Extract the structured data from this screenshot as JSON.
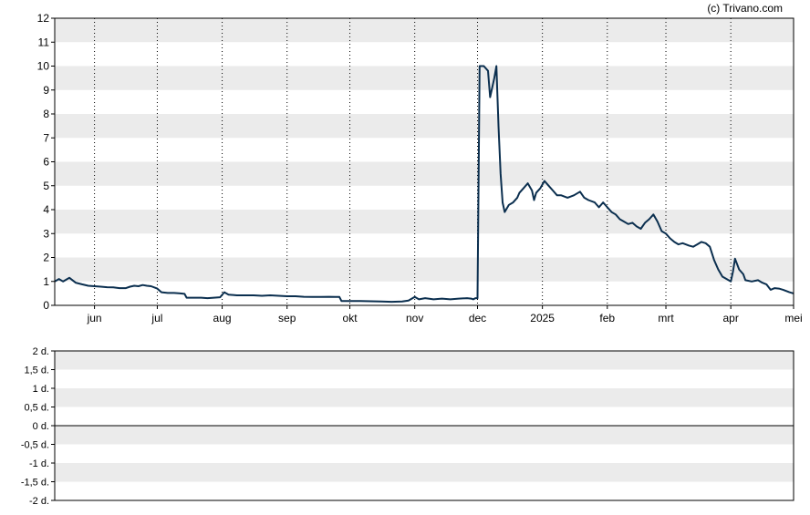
{
  "copyright": "(c) Trivano.com",
  "chart_data": [
    {
      "type": "line",
      "ylim": [
        0,
        12
      ],
      "yticks": [
        "0",
        "1",
        "2",
        "3",
        "4",
        "5",
        "6",
        "7",
        "8",
        "9",
        "10",
        "11",
        "12"
      ],
      "xlim": [
        "2024-05-13",
        "2025-05-01"
      ],
      "xticks": [
        {
          "date": "2024-06-01",
          "label": "jun"
        },
        {
          "date": "2024-07-01",
          "label": "jul"
        },
        {
          "date": "2024-08-01",
          "label": "aug"
        },
        {
          "date": "2024-09-01",
          "label": "sep"
        },
        {
          "date": "2024-10-01",
          "label": "okt"
        },
        {
          "date": "2024-11-01",
          "label": "nov"
        },
        {
          "date": "2024-12-01",
          "label": "dec"
        },
        {
          "date": "2025-01-01",
          "label": "2025"
        },
        {
          "date": "2025-02-01",
          "label": "feb"
        },
        {
          "date": "2025-03-01",
          "label": "mrt"
        },
        {
          "date": "2025-04-01",
          "label": "apr"
        },
        {
          "date": "2025-05-01",
          "label": "mei"
        }
      ],
      "grid": "alternating horizontal bands, dotted vertical lines at month ticks",
      "line_color": "#0b2f4f",
      "series": [
        {
          "points": [
            [
              "2024-05-13",
              1.0
            ],
            [
              "2024-05-15",
              1.1
            ],
            [
              "2024-05-17",
              1.0
            ],
            [
              "2024-05-20",
              1.15
            ],
            [
              "2024-05-23",
              0.95
            ],
            [
              "2024-05-26",
              0.88
            ],
            [
              "2024-05-29",
              0.82
            ],
            [
              "2024-06-01",
              0.8
            ],
            [
              "2024-06-04",
              0.78
            ],
            [
              "2024-06-07",
              0.76
            ],
            [
              "2024-06-10",
              0.75
            ],
            [
              "2024-06-13",
              0.72
            ],
            [
              "2024-06-16",
              0.72
            ],
            [
              "2024-06-18",
              0.78
            ],
            [
              "2024-06-20",
              0.82
            ],
            [
              "2024-06-22",
              0.8
            ],
            [
              "2024-06-24",
              0.85
            ],
            [
              "2024-06-26",
              0.82
            ],
            [
              "2024-06-28",
              0.8
            ],
            [
              "2024-07-01",
              0.7
            ],
            [
              "2024-07-03",
              0.55
            ],
            [
              "2024-07-06",
              0.52
            ],
            [
              "2024-07-09",
              0.52
            ],
            [
              "2024-07-12",
              0.5
            ],
            [
              "2024-07-14",
              0.48
            ],
            [
              "2024-07-15",
              0.32
            ],
            [
              "2024-07-18",
              0.32
            ],
            [
              "2024-07-22",
              0.32
            ],
            [
              "2024-07-25",
              0.3
            ],
            [
              "2024-07-28",
              0.32
            ],
            [
              "2024-07-31",
              0.34
            ],
            [
              "2024-08-02",
              0.55
            ],
            [
              "2024-08-04",
              0.45
            ],
            [
              "2024-08-08",
              0.42
            ],
            [
              "2024-08-12",
              0.42
            ],
            [
              "2024-08-16",
              0.42
            ],
            [
              "2024-08-20",
              0.4
            ],
            [
              "2024-08-24",
              0.42
            ],
            [
              "2024-08-28",
              0.4
            ],
            [
              "2024-09-01",
              0.38
            ],
            [
              "2024-09-05",
              0.38
            ],
            [
              "2024-09-09",
              0.36
            ],
            [
              "2024-09-13",
              0.35
            ],
            [
              "2024-09-17",
              0.35
            ],
            [
              "2024-09-21",
              0.36
            ],
            [
              "2024-09-24",
              0.35
            ],
            [
              "2024-09-26",
              0.35
            ],
            [
              "2024-09-27",
              0.18
            ],
            [
              "2024-10-01",
              0.18
            ],
            [
              "2024-10-06",
              0.18
            ],
            [
              "2024-10-11",
              0.17
            ],
            [
              "2024-10-16",
              0.16
            ],
            [
              "2024-10-21",
              0.15
            ],
            [
              "2024-10-26",
              0.16
            ],
            [
              "2024-10-29",
              0.2
            ],
            [
              "2024-11-01",
              0.35
            ],
            [
              "2024-11-03",
              0.25
            ],
            [
              "2024-11-06",
              0.3
            ],
            [
              "2024-11-10",
              0.25
            ],
            [
              "2024-11-14",
              0.28
            ],
            [
              "2024-11-18",
              0.25
            ],
            [
              "2024-11-22",
              0.28
            ],
            [
              "2024-11-26",
              0.3
            ],
            [
              "2024-11-28",
              0.28
            ],
            [
              "2024-11-29",
              0.25
            ],
            [
              "2024-11-30",
              0.3
            ],
            [
              "2024-12-01",
              0.3
            ],
            [
              "2024-12-02",
              10.0
            ],
            [
              "2024-12-04",
              10.0
            ],
            [
              "2024-12-06",
              9.8
            ],
            [
              "2024-12-07",
              8.7
            ],
            [
              "2024-12-09",
              9.5
            ],
            [
              "2024-12-10",
              10.0
            ],
            [
              "2024-12-11",
              7.5
            ],
            [
              "2024-12-12",
              5.5
            ],
            [
              "2024-12-13",
              4.3
            ],
            [
              "2024-12-14",
              3.9
            ],
            [
              "2024-12-16",
              4.2
            ],
            [
              "2024-12-18",
              4.3
            ],
            [
              "2024-12-20",
              4.5
            ],
            [
              "2024-12-21",
              4.7
            ],
            [
              "2024-12-23",
              4.9
            ],
            [
              "2024-12-25",
              5.1
            ],
            [
              "2024-12-27",
              4.8
            ],
            [
              "2024-12-28",
              4.4
            ],
            [
              "2024-12-29",
              4.7
            ],
            [
              "2024-12-31",
              4.9
            ],
            [
              "2025-01-02",
              5.2
            ],
            [
              "2025-01-04",
              5.0
            ],
            [
              "2025-01-06",
              4.8
            ],
            [
              "2025-01-08",
              4.6
            ],
            [
              "2025-01-10",
              4.6
            ],
            [
              "2025-01-13",
              4.5
            ],
            [
              "2025-01-16",
              4.6
            ],
            [
              "2025-01-19",
              4.75
            ],
            [
              "2025-01-21",
              4.5
            ],
            [
              "2025-01-23",
              4.4
            ],
            [
              "2025-01-26",
              4.3
            ],
            [
              "2025-01-28",
              4.1
            ],
            [
              "2025-01-30",
              4.3
            ],
            [
              "2025-02-01",
              4.1
            ],
            [
              "2025-02-03",
              3.9
            ],
            [
              "2025-02-05",
              3.8
            ],
            [
              "2025-02-07",
              3.6
            ],
            [
              "2025-02-09",
              3.5
            ],
            [
              "2025-02-11",
              3.4
            ],
            [
              "2025-02-13",
              3.45
            ],
            [
              "2025-02-15",
              3.3
            ],
            [
              "2025-02-17",
              3.2
            ],
            [
              "2025-02-19",
              3.45
            ],
            [
              "2025-02-21",
              3.6
            ],
            [
              "2025-02-23",
              3.8
            ],
            [
              "2025-02-25",
              3.5
            ],
            [
              "2025-02-27",
              3.1
            ],
            [
              "2025-03-01",
              3.0
            ],
            [
              "2025-03-03",
              2.8
            ],
            [
              "2025-03-05",
              2.65
            ],
            [
              "2025-03-07",
              2.55
            ],
            [
              "2025-03-09",
              2.6
            ],
            [
              "2025-03-12",
              2.5
            ],
            [
              "2025-03-14",
              2.45
            ],
            [
              "2025-03-16",
              2.55
            ],
            [
              "2025-03-18",
              2.65
            ],
            [
              "2025-03-20",
              2.6
            ],
            [
              "2025-03-22",
              2.45
            ],
            [
              "2025-03-24",
              1.9
            ],
            [
              "2025-03-26",
              1.5
            ],
            [
              "2025-03-28",
              1.2
            ],
            [
              "2025-03-30",
              1.1
            ],
            [
              "2025-04-01",
              1.0
            ],
            [
              "2025-04-02",
              1.4
            ],
            [
              "2025-04-03",
              1.95
            ],
            [
              "2025-04-05",
              1.5
            ],
            [
              "2025-04-07",
              1.3
            ],
            [
              "2025-04-08",
              1.05
            ],
            [
              "2025-04-11",
              1.0
            ],
            [
              "2025-04-14",
              1.05
            ],
            [
              "2025-04-16",
              0.95
            ],
            [
              "2025-04-18",
              0.88
            ],
            [
              "2025-04-20",
              0.65
            ],
            [
              "2025-04-22",
              0.72
            ],
            [
              "2025-04-24",
              0.7
            ],
            [
              "2025-04-26",
              0.65
            ],
            [
              "2025-04-29",
              0.55
            ],
            [
              "2025-05-01",
              0.5
            ]
          ]
        }
      ]
    },
    {
      "type": "line",
      "ylim": [
        -2,
        2
      ],
      "yticks": [
        "-2 d.",
        "-1,5 d.",
        "-1 d.",
        "-0,5 d.",
        "0 d.",
        "0,5 d.",
        "1 d.",
        "1,5 d.",
        "2 d."
      ],
      "grid": "alternating horizontal bands",
      "zero_line": true,
      "series": []
    }
  ]
}
